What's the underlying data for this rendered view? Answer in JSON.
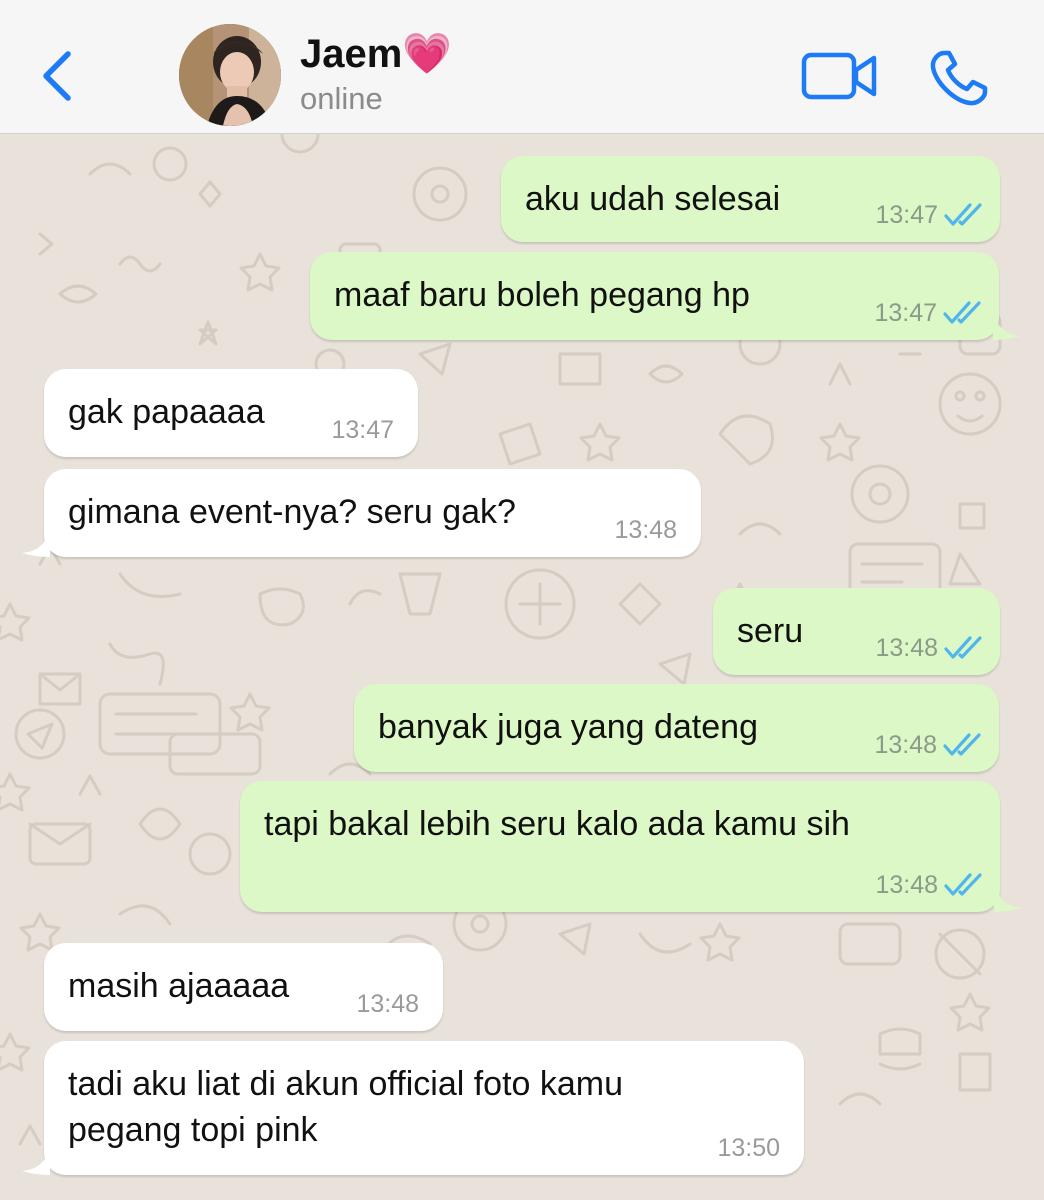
{
  "header": {
    "contact_name": "Jaem",
    "name_emoji": "💗",
    "status": "online",
    "accent_color": "#1d7bf5"
  },
  "icons": {
    "back": "chevron-left-icon",
    "video": "video-camera-icon",
    "call": "phone-icon",
    "read_receipt": "double-check-icon"
  },
  "colors": {
    "outgoing_bubble": "#dcf8c6",
    "incoming_bubble": "#ffffff",
    "read_ticks": "#4fb6ec",
    "wallpaper": "#e9e2da"
  },
  "messages": [
    {
      "direction": "out",
      "text": "aku udah selesai",
      "time": "13:47",
      "read": true
    },
    {
      "direction": "out",
      "text": "maaf baru boleh pegang hp",
      "time": "13:47",
      "read": true
    },
    {
      "direction": "in",
      "text": "gak papaaaa",
      "time": "13:47"
    },
    {
      "direction": "in",
      "text": "gimana event-nya? seru gak?",
      "time": "13:48"
    },
    {
      "direction": "out",
      "text": "seru",
      "time": "13:48",
      "read": true
    },
    {
      "direction": "out",
      "text": "banyak juga yang dateng",
      "time": "13:48",
      "read": true
    },
    {
      "direction": "out",
      "text": "tapi bakal lebih seru kalo ada kamu sih",
      "time": "13:48",
      "read": true
    },
    {
      "direction": "in",
      "text": "masih ajaaaaa",
      "time": "13:48"
    },
    {
      "direction": "in",
      "text": "tadi aku liat di akun official foto kamu\npegang topi pink",
      "time": "13:50"
    }
  ]
}
